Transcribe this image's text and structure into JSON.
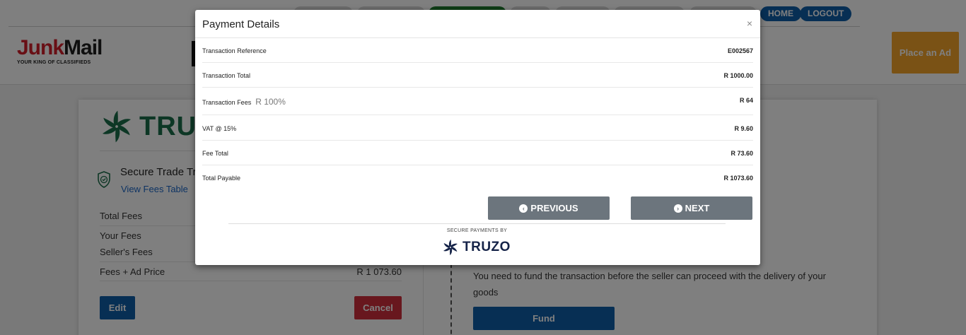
{
  "nav": {
    "home_label": "HOME",
    "logout_label": "LOGOUT"
  },
  "brand": {
    "junk": "Junk",
    "mail": "Mail",
    "tagline": "YOUR KING OF CLASSIFIEDS"
  },
  "header": {
    "place_ad_label": "Place an Ad"
  },
  "secure_trade": {
    "logo_text": "TRUZ",
    "title": "Secure Trade Tr",
    "view_fees_link": "View Fees Table",
    "rows": [
      {
        "label": "Total Fees",
        "value": ""
      },
      {
        "label": "Your Fees",
        "value": ""
      },
      {
        "label": "Seller's Fees",
        "value": ""
      },
      {
        "label": "Fees + Ad Price",
        "value": "R 1 073.60"
      }
    ],
    "edit_label": "Edit",
    "cancel_label": "Cancel"
  },
  "funding": {
    "message": "You need to fund the transaction before the seller can proceed with the delivery of your goods",
    "fund_label": "Fund"
  },
  "modal": {
    "title": "Payment Details",
    "close_symbol": "×",
    "rows": [
      {
        "label": "Transaction Reference",
        "value": "E002567",
        "extra": ""
      },
      {
        "label": "Transaction Total",
        "value": "R 1000.00",
        "extra": ""
      },
      {
        "label": "Transaction Fees",
        "value": "R 64",
        "extra": "R 100%"
      },
      {
        "label": "VAT @ 15%",
        "value": "R 9.60",
        "extra": ""
      },
      {
        "label": "Fee Total",
        "value": "R 73.60",
        "extra": ""
      },
      {
        "label": "Total Payable",
        "value": "R 1073.60",
        "extra": ""
      }
    ],
    "previous_label": "PREVIOUS",
    "next_label": "NEXT",
    "secure_payments_by": "SECURE PAYMENTS BY",
    "truzo_wordmark": "TRUZO"
  },
  "colors": {
    "primary_blue": "#0f5ea8",
    "cancel_red": "#d12e3c",
    "place_ad_orange": "#f5a52a",
    "nav_button_gray": "#6c757d",
    "truzo_green": "#1b6e4a",
    "truzo_navy": "#152348"
  },
  "icons": [
    "truzo-pinwheel-icon",
    "shield-check-icon",
    "chevron-left-circle-icon",
    "chevron-right-circle-icon",
    "close-icon"
  ]
}
